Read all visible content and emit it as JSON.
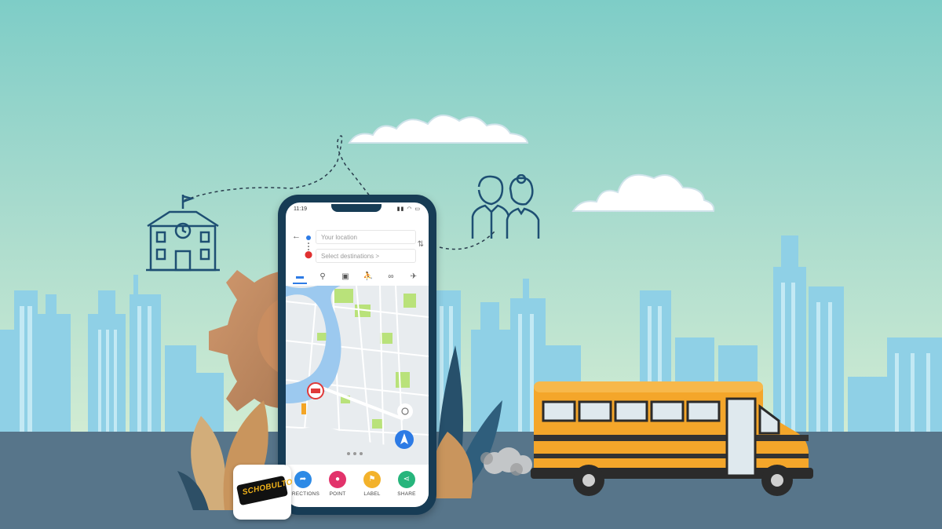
{
  "phone": {
    "status_time": "11:19",
    "status_icons": "▮▮ ◠ ▭",
    "back_icon": "←",
    "swap_icon": "⇅",
    "pin_icon": "⬤",
    "your_location_placeholder": "Your location",
    "select_destinations_placeholder": "Select destinations  >",
    "modes": [
      {
        "name": "car-icon",
        "glyph": "🚗",
        "active": true
      },
      {
        "name": "motorbike-icon",
        "glyph": "🏍"
      },
      {
        "name": "bus-icon",
        "glyph": "🚌"
      },
      {
        "name": "walk-icon",
        "glyph": "🚶"
      },
      {
        "name": "bike-icon",
        "glyph": "🚲"
      },
      {
        "name": "plane-icon",
        "glyph": "✈"
      }
    ],
    "actions": [
      {
        "label": "DIRECTIONS",
        "color": "#2d8ae6",
        "glyph": "➦"
      },
      {
        "label": "POINT",
        "color": "#e2336b",
        "glyph": "●"
      },
      {
        "label": "LABEL",
        "color": "#f3b22b",
        "glyph": "⚑"
      },
      {
        "label": "SHARE",
        "color": "#27b57c",
        "glyph": "⋖"
      }
    ]
  },
  "app_logo_text": "SCHOBULTO",
  "colors": {
    "sky_top": "#7ecdc7",
    "road": "#57758a",
    "buildings": "#8fd0e6",
    "bus_yellow": "#f4a62a",
    "phone_frame": "#173c55",
    "icons_navy": "#1e4f73"
  }
}
